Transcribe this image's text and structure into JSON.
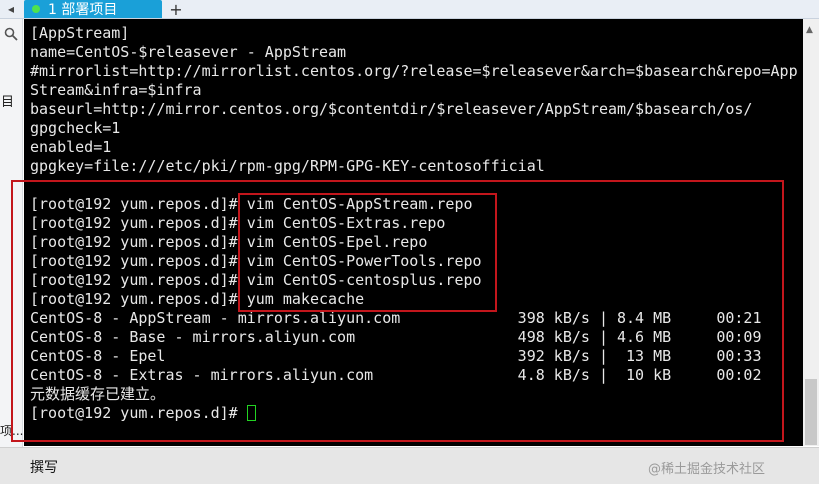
{
  "tabbar": {
    "nav_glyph": "◂",
    "active_tab_label": "1 部署项目",
    "add_glyph": "+"
  },
  "left_panel": {
    "label": "目",
    "bottom_label_1": "项...",
    "bottom_label_2": "..."
  },
  "terminal": {
    "lines": [
      "[AppStream]",
      "name=CentOS-$releasever - AppStream",
      "#mirrorlist=http://mirrorlist.centos.org/?release=$releasever&arch=$basearch&repo=App",
      "Stream&infra=$infra",
      "baseurl=http://mirror.centos.org/$contentdir/$releasever/AppStream/$basearch/os/",
      "gpgcheck=1",
      "enabled=1",
      "gpgkey=file:///etc/pki/rpm-gpg/RPM-GPG-KEY-centosofficial",
      "",
      "[root@192 yum.repos.d]# vim CentOS-AppStream.repo",
      "[root@192 yum.repos.d]# vim CentOS-Extras.repo",
      "[root@192 yum.repos.d]# vim CentOS-Epel.repo",
      "[root@192 yum.repos.d]# vim CentOS-PowerTools.repo",
      "[root@192 yum.repos.d]# vim CentOS-centosplus.repo",
      "[root@192 yum.repos.d]# yum makecache",
      "CentOS-8 - AppStream - mirrors.aliyun.com             398 kB/s | 8.4 MB     00:21",
      "CentOS-8 - Base - mirrors.aliyun.com                  498 kB/s | 4.6 MB     00:09",
      "CentOS-8 - Epel                                       392 kB/s |  13 MB     00:33",
      "CentOS-8 - Extras - mirrors.aliyun.com                4.8 kB/s |  10 kB     00:02",
      "元数据缓存已建立。"
    ],
    "prompt": "[root@192 yum.repos.d]# "
  },
  "bottombar": {
    "compose_label": "撰写",
    "watermark": "@稀土掘金技术社区"
  },
  "colors": {
    "terminal_bg": "#000000",
    "terminal_fg": "#e8e8e8",
    "tab_active": "#1aa0d8",
    "annotation": "#c3161c",
    "cursor": "#22d322"
  }
}
